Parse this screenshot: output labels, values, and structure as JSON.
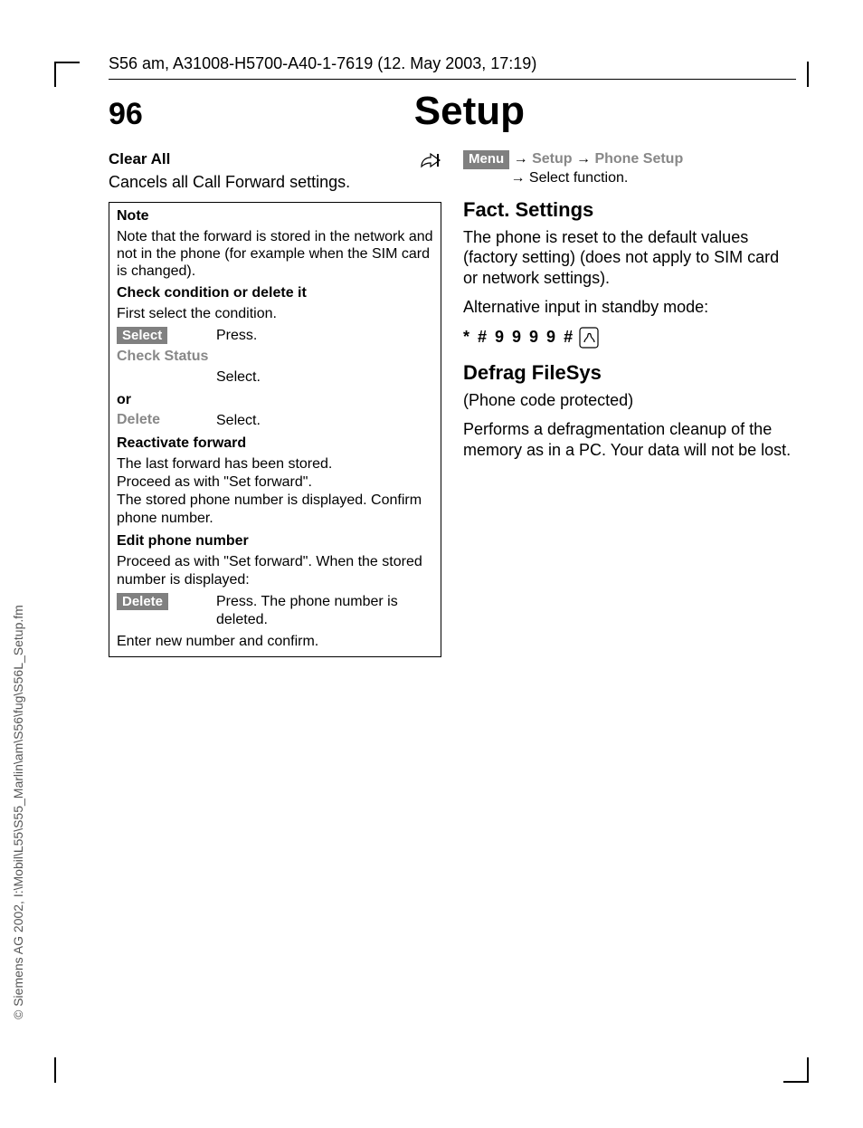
{
  "header": {
    "file_line": "S56 am, A31008-H5700-A40-1-7619 (12. May 2003, 17:19)",
    "page_num": "96",
    "title": "Setup"
  },
  "left": {
    "clear_all": "Clear All",
    "clear_all_body": "Cancels all Call Forward settings.",
    "note": {
      "title": "Note",
      "body": "Note that the forward is stored in the network and not in the phone (for example when the SIM card is changed).",
      "check_title": "Check condition or delete it",
      "first_select": "First select the condition.",
      "select_key": "Select",
      "press": "Press.",
      "check_status": "Check Status",
      "select_word": "Select.",
      "or": "or",
      "delete_grey": "Delete",
      "reactivate_title": "Reactivate forward",
      "reactivate_body": "The last forward has been stored.\nProceed as with \"Set forward\".\nThe stored phone number is displayed. Confirm phone number.",
      "edit_title": "Edit phone number",
      "edit_body": "Proceed as with \"Set forward\". When the stored number is displayed:",
      "delete_key": "Delete",
      "delete_action": "Press. The phone number is deleted.",
      "enter_new": "Enter new number and confirm."
    }
  },
  "right": {
    "menu_key": "Menu",
    "arrow": "→",
    "setup": "Setup",
    "phone_setup": "Phone Setup",
    "select_fn": "Select function.",
    "fact_title": "Fact. Settings",
    "fact_body": "The phone is reset to the default values (factory setting) (does not apply to SIM card or network settings).",
    "alt_input": "Alternative input in standby mode:",
    "code": "* # 9 9 9 9 #",
    "defrag_title": "Defrag FileSys",
    "defrag_sub": "(Phone code protected)",
    "defrag_body": "Performs a defragmentation cleanup of the memory as in a PC.  Your data will not be lost."
  },
  "side": "© Siemens AG 2002, I:\\Mobil\\L55\\S55_Marlin\\am\\S56\\fug\\S56L_Setup.fm"
}
